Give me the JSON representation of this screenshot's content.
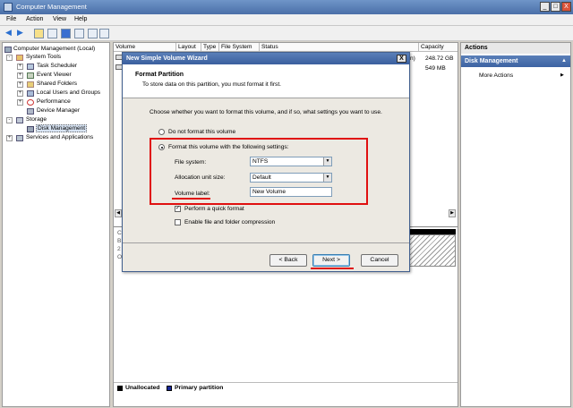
{
  "window": {
    "title": "Computer Management",
    "min": "_",
    "max": "□",
    "close": "X"
  },
  "menu": [
    "File",
    "Action",
    "View",
    "Help"
  ],
  "toolbar": {
    "back": "◀",
    "forward": "▶"
  },
  "tree": [
    {
      "label": "Computer Management (Local)",
      "level": 0,
      "expander": ""
    },
    {
      "label": "System Tools",
      "level": 1,
      "expander": "-"
    },
    {
      "label": "Task Scheduler",
      "level": 2,
      "expander": "+"
    },
    {
      "label": "Event Viewer",
      "level": 2,
      "expander": "+"
    },
    {
      "label": "Shared Folders",
      "level": 2,
      "expander": "+"
    },
    {
      "label": "Local Users and Groups",
      "level": 2,
      "expander": "+"
    },
    {
      "label": "Performance",
      "level": 2,
      "expander": "+"
    },
    {
      "label": "Device Manager",
      "level": 2,
      "expander": ""
    },
    {
      "label": "Storage",
      "level": 1,
      "expander": "-"
    },
    {
      "label": "Disk Management",
      "level": 2,
      "expander": ""
    },
    {
      "label": "Services and Applications",
      "level": 1,
      "expander": "+"
    }
  ],
  "columns": [
    "Volume",
    "Layout",
    "Type",
    "File System",
    "Status",
    "Capacity"
  ],
  "capacity_values": [
    "248.72 GB",
    "549 MB"
  ],
  "row_fragment": "n)",
  "disk_fragments": [
    "C",
    "B",
    "2",
    "O"
  ],
  "actions": {
    "header": "Actions",
    "section": "Disk Management",
    "item": "More Actions"
  },
  "dialog": {
    "title": "New Simple Volume Wizard",
    "close": "X",
    "heading": "Format Partition",
    "subheading": "To store data on this partition, you must format it first.",
    "question": "Choose whether you want to format this volume, and if so, what settings you want to use.",
    "option_no_format": "Do not format this volume",
    "option_format": "Format this volume with the following settings:",
    "file_system_label": "File system:",
    "file_system_value": "NTFS",
    "alloc_label": "Allocation unit size:",
    "alloc_value": "Default",
    "volume_label_label": "Volume label:",
    "volume_label_value": "New Volume",
    "quick_format": "Perform a quick format",
    "compression": "Enable file and folder compression",
    "back_button": "< Back",
    "next_button": "Next >",
    "cancel_button": "Cancel"
  },
  "legend": [
    {
      "label": "Unallocated",
      "color": "#000000"
    },
    {
      "label": "Primary partition",
      "color": "#1a2a9a"
    }
  ],
  "colors": {
    "titlebar": "#4a6fa8",
    "highlight": "#e01010",
    "accent": "#3d63a3"
  }
}
